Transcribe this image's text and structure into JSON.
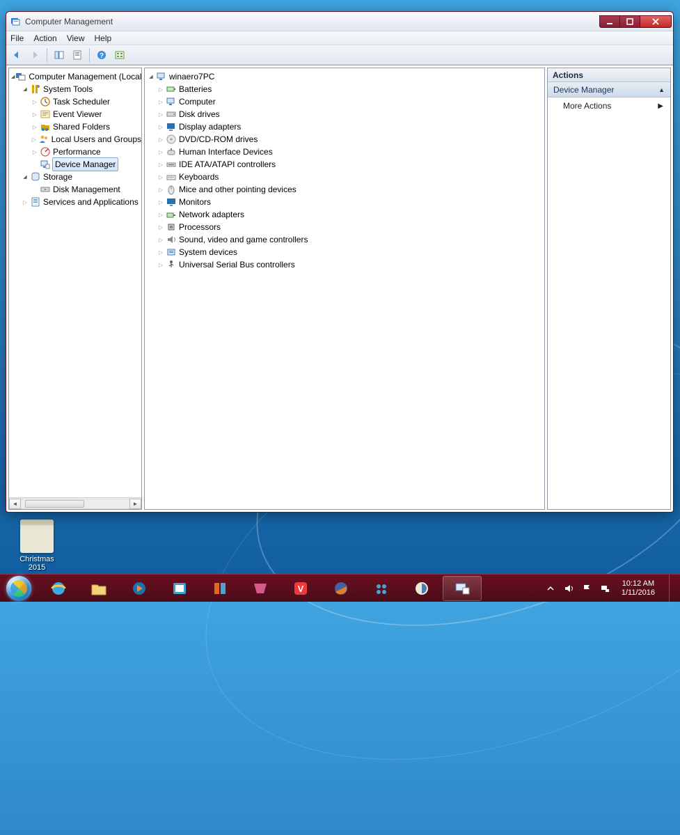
{
  "window": {
    "title": "Computer Management"
  },
  "menubar": [
    "File",
    "Action",
    "View",
    "Help"
  ],
  "left_tree": {
    "root": "Computer Management (Local",
    "system_tools": {
      "label": "System Tools",
      "children": [
        "Task Scheduler",
        "Event Viewer",
        "Shared Folders",
        "Local Users and Groups",
        "Performance",
        "Device Manager"
      ]
    },
    "storage": {
      "label": "Storage",
      "children": [
        "Disk Management"
      ]
    },
    "services": {
      "label": "Services and Applications"
    }
  },
  "mid_tree": {
    "root": "winaero7PC",
    "children": [
      "Batteries",
      "Computer",
      "Disk drives",
      "Display adapters",
      "DVD/CD-ROM drives",
      "Human Interface Devices",
      "IDE ATA/ATAPI controllers",
      "Keyboards",
      "Mice and other pointing devices",
      "Monitors",
      "Network adapters",
      "Processors",
      "Sound, video and game controllers",
      "System devices",
      "Universal Serial Bus controllers"
    ]
  },
  "actions": {
    "header": "Actions",
    "sub": "Device Manager",
    "item": "More Actions"
  },
  "desktop_icon": {
    "line1": "Christmas",
    "line2": "2015"
  },
  "tray": {
    "time": "10:12 AM",
    "date": "1/11/2016"
  }
}
